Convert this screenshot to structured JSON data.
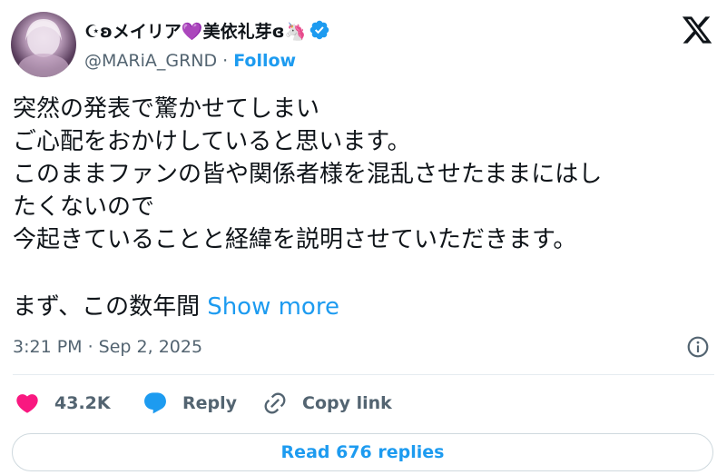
{
  "author": {
    "display_name": "☪ʚメイリア💜美依礼芽ɞ🦄",
    "handle": "@MARiA_GRND",
    "separator": "·",
    "follow_label": "Follow",
    "verified": true,
    "verified_color": "#1d9bf0"
  },
  "tweet": {
    "text": "突然の発表で驚かせてしまい\nご心配をおかけしていると思います。\nこのままファンの皆や関係者様を混乱させたままにはし\nたくないので\n今起きていることと経緯を説明させていただきます。",
    "truncated_line": "まず、この数年間",
    "show_more_label": "Show more",
    "timestamp": "3:21 PM · Sep 2, 2025"
  },
  "actions": {
    "like_count": "43.2K",
    "like_color": "#f91880",
    "reply_label": "Reply",
    "copy_link_label": "Copy link"
  },
  "footer": {
    "read_replies_label": "Read 676 replies"
  },
  "colors": {
    "accent": "#1d9bf0",
    "text": "#0f1419",
    "secondary_text": "#536471"
  }
}
